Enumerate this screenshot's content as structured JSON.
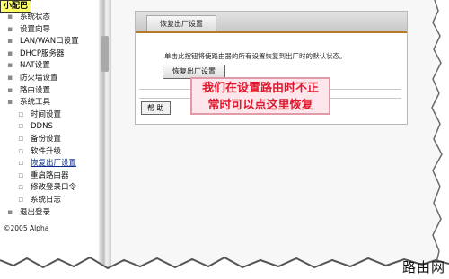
{
  "top_label": "小配巴",
  "sidebar": {
    "items": [
      {
        "label": "系统状态",
        "level": 0
      },
      {
        "label": "设置向导",
        "level": 0
      },
      {
        "label": "LAN/WAN口设置",
        "level": 0
      },
      {
        "label": "DHCP服务器",
        "level": 0
      },
      {
        "label": "NAT设置",
        "level": 0
      },
      {
        "label": "防火墙设置",
        "level": 0
      },
      {
        "label": "路由设置",
        "level": 0
      },
      {
        "label": "系统工具",
        "level": 0
      },
      {
        "label": "时间设置",
        "level": 1
      },
      {
        "label": "DDNS",
        "level": 1
      },
      {
        "label": "备份设置",
        "level": 1
      },
      {
        "label": "软件升级",
        "level": 1
      },
      {
        "label": "恢复出厂设置",
        "level": 1,
        "active": true
      },
      {
        "label": "重启路由器",
        "level": 1
      },
      {
        "label": "修改登录口令",
        "level": 1
      },
      {
        "label": "系统日志",
        "level": 1
      },
      {
        "label": "退出登录",
        "level": 0
      }
    ],
    "copyright": "©2005 Alpha"
  },
  "panel": {
    "title": "恢复出厂设置",
    "description": "单击此按钮将使路由器的所有设置恢复到出厂时的默认状态。",
    "factory_button": "恢复出厂设置",
    "help_button": "帮 助"
  },
  "annotation": {
    "line1": "我们在设置路由时不正",
    "line2": "常时可以点这里恢复"
  },
  "watermark": "路由网",
  "colors": {
    "header_accent": "#b47a2a",
    "annotation_text": "#e0182e",
    "annotation_bg": "#fde6ec",
    "active_link": "#0a2a8a"
  }
}
